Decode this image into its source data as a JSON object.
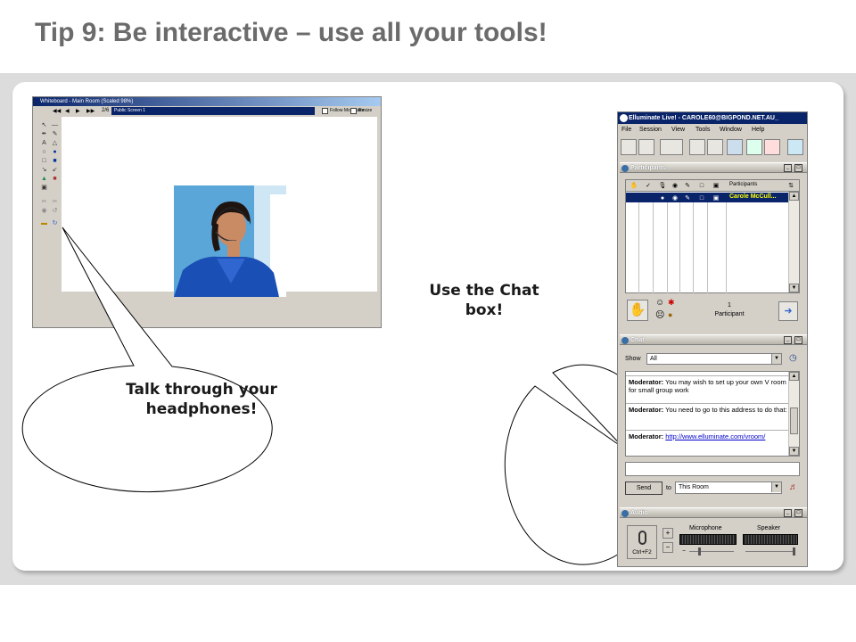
{
  "slide": {
    "title": "Tip 9: Be interactive – use all your tools!"
  },
  "whiteboard": {
    "title": "Whiteboard - Main Room (Scaled 98%)",
    "page": "2/6",
    "screen": "Public Screen 1",
    "follow_moderator_label": "Follow Moderator",
    "resize_label": "Resize",
    "tools": [
      "pointer-icon",
      "line-icon",
      "pen-icon",
      "highlighter-icon",
      "text-icon",
      "shape-icon",
      "rectangle-icon",
      "ellipse-icon",
      "fill-icon",
      "arrow-icon",
      "clipart-icon",
      "screen-icon",
      "cut-icon",
      "copy-icon",
      "folder-icon",
      "refresh-icon"
    ]
  },
  "bubbles": {
    "headphones": "Talk through your headphones!",
    "chat": "Use the Chat box!"
  },
  "elluminate": {
    "title": "Elluminate Live! - CAROLE60@BIGPOND.NET.AU_",
    "menu": [
      "File",
      "Session",
      "View",
      "Tools",
      "Window",
      "Help"
    ],
    "participants_panel": {
      "title": "Participants",
      "column_label": "Participants",
      "participant_name": "Carole McCull...",
      "count": "1",
      "count_label": "Participant"
    },
    "chat_panel": {
      "title": "Chat",
      "show_label": "Show",
      "show_value": "All",
      "messages": [
        {
          "sender": "Moderator:",
          "text": "You may wish to set up your own V room for small group work"
        },
        {
          "sender": "Moderator:",
          "text": "You need to go to this address to do that:"
        },
        {
          "sender": "Moderator:",
          "text": "http://www.elluminate.com/vroom/"
        }
      ],
      "send_label": "Send",
      "to_label": "to",
      "to_value": "This Room"
    },
    "audio_panel": {
      "title": "Audio",
      "mic_button_label": "Ctrl+F2",
      "microphone_label": "Microphone",
      "speaker_label": "Speaker"
    }
  }
}
